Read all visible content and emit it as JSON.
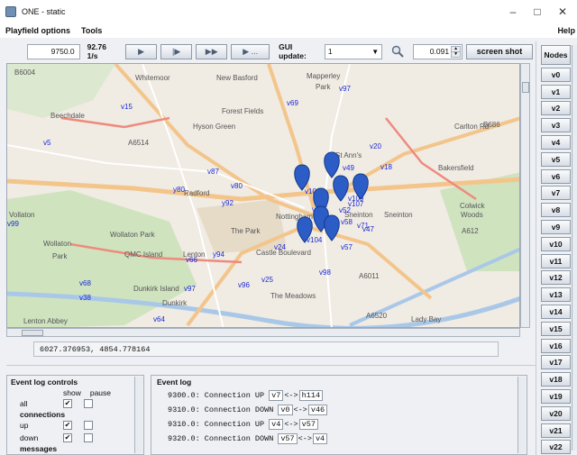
{
  "window": {
    "title": "ONE - static",
    "minimize": "–",
    "maximize": "□",
    "close": "✕"
  },
  "menu": {
    "playfield": "Playfield options",
    "tools": "Tools",
    "help": "Help"
  },
  "toolbar": {
    "sim_time": "9750.0",
    "speed": "92.76 1/s",
    "play": "▶",
    "step": "|▶",
    "ffw": "▶▶",
    "ffw_to": "▶ ...",
    "gui_label": "GUI update:",
    "gui_value": "1",
    "zoom_value": "0.091",
    "screenshot": "screen shot"
  },
  "map": {
    "places": [
      "B6004",
      "Whitemoor",
      "New Basford",
      "Mapperley",
      "Park",
      "Forest Fields",
      "Hyson Green",
      "Beechdale",
      "A6514",
      "St Ann's",
      "Bakersfield",
      "Radford",
      "Sneinton",
      "Nottingham",
      "The Park",
      "Wollaton Park",
      "Wollaton",
      "Park",
      "QMC Island",
      "Lenton",
      "Dunkirk Island",
      "Dunkirk",
      "The Meadows",
      "Lenton Abbey",
      "Lady Bay",
      "A612",
      "A6520",
      "A6011",
      "Vollaton",
      "Sneinton",
      "Colwick",
      "Woods",
      "Castle Boulevard",
      "B686",
      "Carlton Rd"
    ],
    "node_labels": [
      "v5",
      "v15",
      "v87",
      "v69",
      "v97",
      "y80",
      "v80",
      "y92",
      "v20",
      "v49",
      "v43",
      "v18",
      "v52",
      "v106",
      "v107",
      "v105",
      "v109",
      "v24",
      "v66",
      "y94",
      "v104",
      "v58",
      "v47",
      "v57",
      "v71",
      "v98",
      "v25",
      "v96",
      "v97",
      "v68",
      "v38",
      "v64",
      "v9",
      "v99"
    ],
    "pin_color": "#2c5cc6",
    "label_color": "#1a2ad6"
  },
  "coord": "6027.376953, 4854.778164",
  "log_controls": {
    "title": "Event log controls",
    "show": "show",
    "pause": "pause",
    "rows": [
      {
        "name": "all",
        "show": "✔",
        "pause": ""
      },
      {
        "section": "connections"
      },
      {
        "name": "up",
        "show": "✔",
        "pause": ""
      },
      {
        "name": "down",
        "show": "✔",
        "pause": ""
      },
      {
        "section": "messages"
      }
    ]
  },
  "event_log": {
    "title": "Event log",
    "entries": [
      {
        "time": "9300.0: Connection UP",
        "a": "v7",
        "sep": "<->",
        "b": "h114"
      },
      {
        "time": "9310.0: Connection DOWN",
        "a": "v0",
        "sep": "<->",
        "b": "v46"
      },
      {
        "time": "9310.0: Connection UP",
        "a": "v4",
        "sep": "<->",
        "b": "v57"
      },
      {
        "time": "9320.0: Connection DOWN",
        "a": "v57",
        "sep": "<->",
        "b": "v4"
      }
    ]
  },
  "nodes": {
    "title": "Nodes",
    "items": [
      "v0",
      "v1",
      "v2",
      "v3",
      "v4",
      "v5",
      "v6",
      "v7",
      "v8",
      "v9",
      "v10",
      "v11",
      "v12",
      "v13",
      "v14",
      "v15",
      "v16",
      "v17",
      "v18",
      "v19",
      "v20",
      "v21",
      "v22"
    ]
  }
}
